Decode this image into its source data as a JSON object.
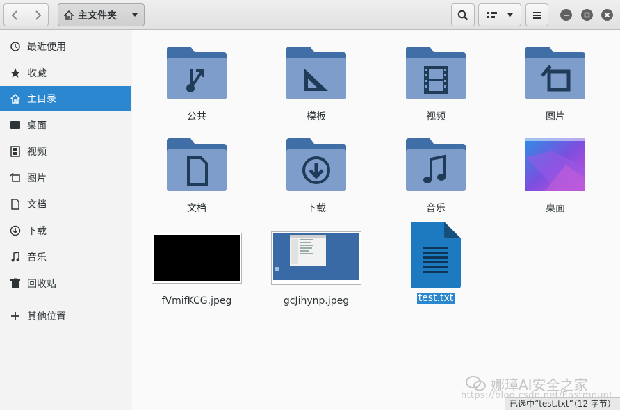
{
  "toolbar": {
    "path_label": "主文件夹",
    "back_icon": "chevron-left-icon",
    "forward_icon": "chevron-right-icon"
  },
  "sidebar": {
    "items": [
      {
        "label": "最近使用",
        "icon": "recent-icon"
      },
      {
        "label": "收藏",
        "icon": "star-icon"
      },
      {
        "label": "主目录",
        "icon": "home-icon",
        "active": true
      },
      {
        "label": "桌面",
        "icon": "desktop-icon"
      },
      {
        "label": "视频",
        "icon": "video-icon"
      },
      {
        "label": "图片",
        "icon": "pictures-icon"
      },
      {
        "label": "文档",
        "icon": "document-icon"
      },
      {
        "label": "下载",
        "icon": "download-icon"
      },
      {
        "label": "音乐",
        "icon": "music-icon"
      },
      {
        "label": "回收站",
        "icon": "trash-icon"
      }
    ],
    "other_locations": "其他位置"
  },
  "files": [
    {
      "name": "公共",
      "type": "folder",
      "emblem": "share"
    },
    {
      "name": "模板",
      "type": "folder",
      "emblem": "template"
    },
    {
      "name": "视频",
      "type": "folder",
      "emblem": "video"
    },
    {
      "name": "图片",
      "type": "folder",
      "emblem": "pictures"
    },
    {
      "name": "文档",
      "type": "folder",
      "emblem": "document"
    },
    {
      "name": "下载",
      "type": "folder",
      "emblem": "download"
    },
    {
      "name": "音乐",
      "type": "folder",
      "emblem": "music"
    },
    {
      "name": "桌面",
      "type": "folder-thumbnail",
      "emblem": "wallpaper"
    },
    {
      "name": "fVmifKCG.jpeg",
      "type": "image"
    },
    {
      "name": "gcJihynp.jpeg",
      "type": "image"
    },
    {
      "name": "test.txt",
      "type": "text",
      "selected": true
    }
  ],
  "watermark": {
    "text": "娜璋AI安全之家",
    "url": "https://blog.csdn.net/Eastmount"
  },
  "status_text": "已选中“test.txt”（12 字节）",
  "colors": {
    "accent": "#2b87cf",
    "folder_body": "#7e9dca",
    "folder_tab": "#3f6fa6",
    "folder_glyph": "#1f3b58",
    "text_file": "#1e7ac0"
  }
}
